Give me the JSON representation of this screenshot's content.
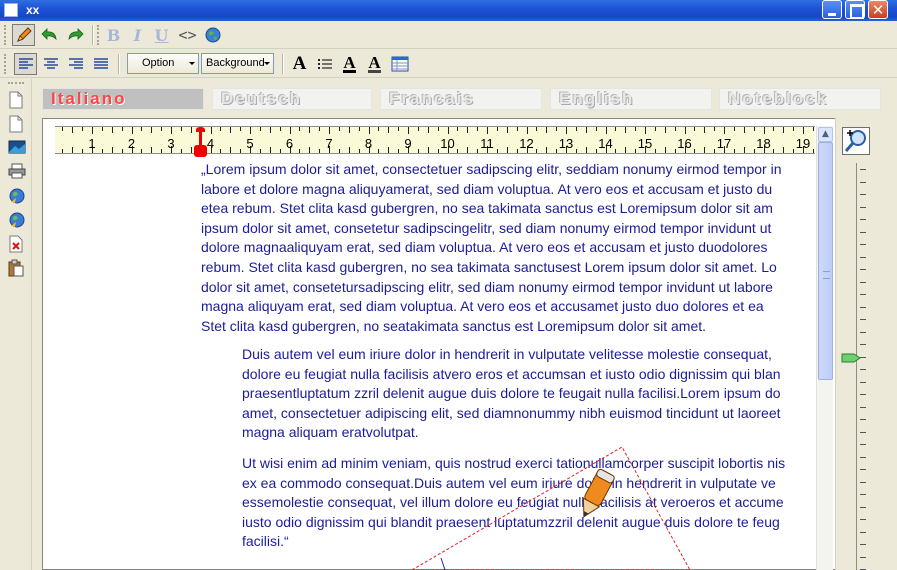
{
  "window": {
    "title": "xx"
  },
  "toolbar": {
    "option_label": "Option",
    "background_label": "Background"
  },
  "language_tabs": [
    "Italiano",
    "Deutsch",
    "Francais",
    "English",
    "Noteblock"
  ],
  "active_tab": "Italiano",
  "ruler": {
    "labels": [
      "1",
      "2",
      "3",
      "4",
      "5",
      "6",
      "7",
      "8",
      "9",
      "10",
      "11",
      "12",
      "13",
      "14",
      "15",
      "16",
      "17",
      "18",
      "19"
    ]
  },
  "document": {
    "para1": [
      "„Lorem ipsum dolor sit amet, consectetuer sadipscing elitr, seddiam nonumy eirmod tempor in",
      "labore et dolore magna aliquyamerat, sed diam voluptua. At vero eos et accusam et justo du",
      "etea rebum. Stet clita kasd gubergren, no sea takimata sanctus est Loremipsum dolor sit am",
      "ipsum dolor sit amet, consetetur sadipscingelitr, sed diam nonumy eirmod tempor invidunt ut",
      "dolore magnaaliquyam erat, sed diam voluptua. At vero eos et accusam et justo duodolores",
      "rebum. Stet clita kasd gubergren, no sea takimata sanctusest Lorem ipsum dolor sit amet. Lo",
      "dolor sit amet, consetetursadipscing elitr, sed diam nonumy eirmod tempor invidunt ut labore",
      "magna aliquyam erat, sed diam voluptua. At vero eos et accusamet justo duo dolores et ea",
      "Stet clita kasd gubergren, no seatakimata sanctus est Loremipsum dolor sit amet."
    ],
    "para2": [
      "Duis autem vel eum iriure dolor in hendrerit in vulputate velitesse molestie consequat,",
      "dolore eu feugiat nulla facilisis atvero eros et accumsan et iusto odio dignissim qui blan",
      "praesentluptatum zzril delenit augue duis dolore te feugait nulla facilisi.Lorem ipsum do",
      "amet, consectetuer adipiscing elit, sed diamnonummy nibh euismod tincidunt ut laoreet",
      "magna aliquam eratvolutpat."
    ],
    "para3": [
      "Ut wisi enim ad minim veniam, quis nostrud exerci tationullamcorper suscipit lobortis nis",
      "ex ea commodo consequat.Duis autem vel eum iriure dolor in hendrerit in vulputate ve",
      "essemolestie consequat, vel illum dolore eu feugiat nulla facilisis at veroeros et accume",
      "iusto odio dignissim qui blandit praesent luptatumzzril delenit augue duis dolore te feug",
      "facilisi.“"
    ]
  },
  "colors": {
    "text": "#1c1c99",
    "active_tab_text": "#ff4444",
    "ruler_marker": "#ee0000"
  },
  "icons": {
    "toolbar1": [
      "pencil-icon",
      "undo-arrow-icon",
      "redo-arrow-icon",
      "bold-icon",
      "italic-icon",
      "underline-icon",
      "code-icon",
      "globe-icon"
    ],
    "toolbar2": [
      "align-left-icon",
      "align-center-icon",
      "align-right-icon",
      "align-justify-icon",
      "font-icon",
      "list-icon",
      "font-color-icon",
      "highlight-icon",
      "table-icon"
    ],
    "sidebar": [
      "new-document-icon",
      "blank-page-icon",
      "image-icon",
      "printer-icon",
      "globe-icon",
      "globe-icon",
      "delete-icon",
      "paste-icon"
    ]
  }
}
